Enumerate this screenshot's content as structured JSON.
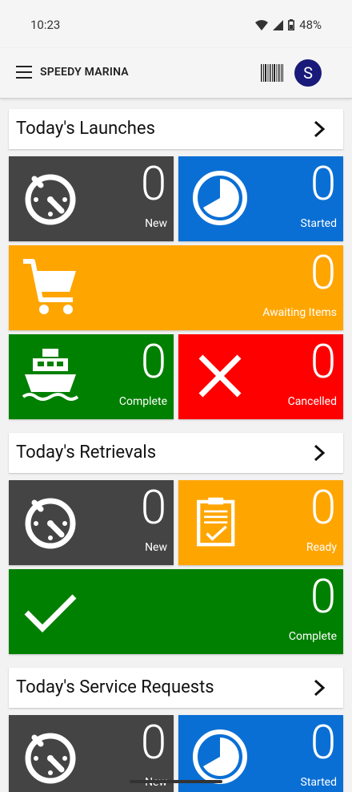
{
  "status": {
    "time": "10:23",
    "battery": "48%"
  },
  "app": {
    "title": "SPEEDY MARINA",
    "avatar_initial": "S"
  },
  "colors": {
    "dark": "#444444",
    "blue": "#0a6fd4",
    "orange": "#ffa500",
    "green": "#008000",
    "red": "#ff0000"
  },
  "launches": {
    "title": "Today's Launches",
    "new_count": "0",
    "new_label": "New",
    "started_count": "0",
    "started_label": "Started",
    "awaiting_count": "0",
    "awaiting_label": "Awaiting Items",
    "complete_count": "0",
    "complete_label": "Complete",
    "cancelled_count": "0",
    "cancelled_label": "Cancelled"
  },
  "retrievals": {
    "title": "Today's Retrievals",
    "new_count": "0",
    "new_label": "New",
    "ready_count": "0",
    "ready_label": "Ready",
    "complete_count": "0",
    "complete_label": "Complete"
  },
  "service": {
    "title": "Today's Service Requests",
    "new_count": "0",
    "new_label": "New",
    "started_count": "0",
    "started_label": "Started"
  }
}
